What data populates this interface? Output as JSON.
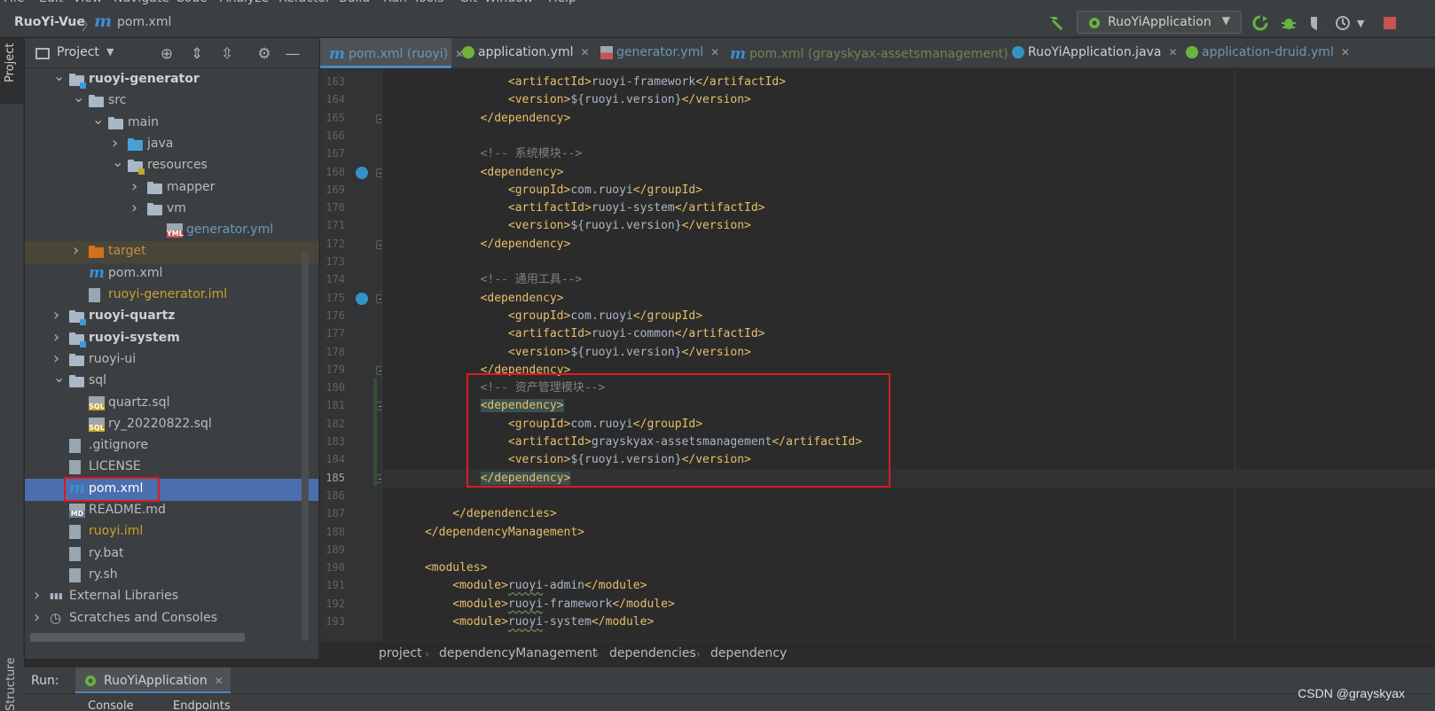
{
  "menu": [
    "File",
    "Edit",
    "View",
    "Navigate",
    "Code",
    "Analyze",
    "Refactor",
    "Build",
    "Run",
    "Tools",
    "Git",
    "Window",
    "Help"
  ],
  "navbar": {
    "project_name": "RuoYi-Vue",
    "file_name": "pom.xml",
    "run_config": "RuoYiApplication"
  },
  "project_panel": {
    "title": "Project"
  },
  "tree": [
    {
      "label": "ruoyi-generator",
      "bold": true
    },
    {
      "label": "src"
    },
    {
      "label": "main"
    },
    {
      "label": "java"
    },
    {
      "label": "resources"
    },
    {
      "label": "mapper"
    },
    {
      "label": "vm"
    },
    {
      "label": "generator.yml"
    },
    {
      "label": "target"
    },
    {
      "label": "pom.xml"
    },
    {
      "label": "ruoyi-generator.iml"
    },
    {
      "label": "ruoyi-quartz",
      "bold": true
    },
    {
      "label": "ruoyi-system",
      "bold": true
    },
    {
      "label": "ruoyi-ui"
    },
    {
      "label": "sql"
    },
    {
      "label": "quartz.sql"
    },
    {
      "label": "ry_20220822.sql"
    },
    {
      "label": ".gitignore"
    },
    {
      "label": "LICENSE"
    },
    {
      "label": "pom.xml",
      "selected": true
    },
    {
      "label": "README.md"
    },
    {
      "label": "ruoyi.iml"
    },
    {
      "label": "ry.bat"
    },
    {
      "label": "ry.sh"
    },
    {
      "label": "External Libraries"
    },
    {
      "label": "Scratches and Consoles"
    }
  ],
  "tabs": [
    {
      "label": "pom.xml (ruoyi)",
      "active": true
    },
    {
      "label": "application.yml"
    },
    {
      "label": "generator.yml"
    },
    {
      "label": "pom.xml (grayskyax-assetsmanagement)"
    },
    {
      "label": "RuoYiApplication.java"
    },
    {
      "label": "application-druid.yml"
    }
  ],
  "code": [
    {
      "n": "163",
      "indent": "            ",
      "parts": [
        [
          "tag",
          "<artifactId>"
        ],
        [
          "txt",
          "ruoyi-framework"
        ],
        [
          "tag",
          "</artifactId>"
        ]
      ]
    },
    {
      "n": "164",
      "indent": "            ",
      "parts": [
        [
          "tag",
          "<version>"
        ],
        [
          "txt",
          "${ruoyi.version}"
        ],
        [
          "tag",
          "</version>"
        ]
      ]
    },
    {
      "n": "165",
      "indent": "        ",
      "parts": [
        [
          "tag",
          "</dependency>"
        ]
      ]
    },
    {
      "n": "166",
      "indent": "",
      "parts": []
    },
    {
      "n": "167",
      "indent": "        ",
      "parts": [
        [
          "comment",
          "<!-- 系统模块-->"
        ]
      ]
    },
    {
      "n": "168",
      "indent": "        ",
      "parts": [
        [
          "tag",
          "<dependency>"
        ]
      ]
    },
    {
      "n": "169",
      "indent": "            ",
      "parts": [
        [
          "tag",
          "<groupId>"
        ],
        [
          "txt",
          "com.ruoyi"
        ],
        [
          "tag",
          "</groupId>"
        ]
      ]
    },
    {
      "n": "170",
      "indent": "            ",
      "parts": [
        [
          "tag",
          "<artifactId>"
        ],
        [
          "txt",
          "ruoyi-system"
        ],
        [
          "tag",
          "</artifactId>"
        ]
      ]
    },
    {
      "n": "171",
      "indent": "            ",
      "parts": [
        [
          "tag",
          "<version>"
        ],
        [
          "txt",
          "${ruoyi.version}"
        ],
        [
          "tag",
          "</version>"
        ]
      ]
    },
    {
      "n": "172",
      "indent": "        ",
      "parts": [
        [
          "tag",
          "</dependency>"
        ]
      ]
    },
    {
      "n": "173",
      "indent": "",
      "parts": []
    },
    {
      "n": "174",
      "indent": "        ",
      "parts": [
        [
          "comment",
          "<!-- 通用工具-->"
        ]
      ]
    },
    {
      "n": "175",
      "indent": "        ",
      "parts": [
        [
          "tag",
          "<dependency>"
        ]
      ]
    },
    {
      "n": "176",
      "indent": "            ",
      "parts": [
        [
          "tag",
          "<groupId>"
        ],
        [
          "txt",
          "com.ruoyi"
        ],
        [
          "tag",
          "</groupId>"
        ]
      ]
    },
    {
      "n": "177",
      "indent": "            ",
      "parts": [
        [
          "tag",
          "<artifactId>"
        ],
        [
          "txt",
          "ruoyi-common"
        ],
        [
          "tag",
          "</artifactId>"
        ]
      ]
    },
    {
      "n": "178",
      "indent": "            ",
      "parts": [
        [
          "tag",
          "<version>"
        ],
        [
          "txt",
          "${ruoyi.version}"
        ],
        [
          "tag",
          "</version>"
        ]
      ]
    },
    {
      "n": "179",
      "indent": "        ",
      "parts": [
        [
          "tag",
          "</dependency>"
        ]
      ]
    },
    {
      "n": "180",
      "indent": "        ",
      "parts": [
        [
          "comment",
          "<!-- 资产管理模块-->"
        ]
      ]
    },
    {
      "n": "181",
      "indent": "        ",
      "parts": [
        [
          "taghl",
          "<dependency>"
        ]
      ]
    },
    {
      "n": "182",
      "indent": "            ",
      "parts": [
        [
          "tag",
          "<groupId>"
        ],
        [
          "txt",
          "com.ruoyi"
        ],
        [
          "tag",
          "</groupId>"
        ]
      ]
    },
    {
      "n": "183",
      "indent": "            ",
      "parts": [
        [
          "tag",
          "<artifactId>"
        ],
        [
          "txt",
          "grayskyax-assetsmanagement"
        ],
        [
          "tag",
          "</artifactId>"
        ]
      ]
    },
    {
      "n": "184",
      "indent": "            ",
      "parts": [
        [
          "tag",
          "<version>"
        ],
        [
          "txt",
          "${ruoyi.version}"
        ],
        [
          "tag",
          "</version>"
        ]
      ]
    },
    {
      "n": "185",
      "indent": "        ",
      "parts": [
        [
          "taghl",
          "</dependency>"
        ]
      ],
      "current": true
    },
    {
      "n": "186",
      "indent": "",
      "parts": []
    },
    {
      "n": "187",
      "indent": "    ",
      "parts": [
        [
          "tag",
          "</dependencies>"
        ]
      ]
    },
    {
      "n": "188",
      "indent": "",
      "parts": [
        [
          "tag",
          "</dependencyManagement>"
        ]
      ]
    },
    {
      "n": "189",
      "indent": "",
      "parts": []
    },
    {
      "n": "190",
      "indent": "",
      "parts": [
        [
          "tag",
          "<modules>"
        ]
      ]
    },
    {
      "n": "191",
      "indent": "    ",
      "parts": [
        [
          "tag",
          "<module>"
        ],
        [
          "sq",
          "ruoyi"
        ],
        [
          "txt",
          "-admin"
        ],
        [
          "tag",
          "</module>"
        ]
      ]
    },
    {
      "n": "192",
      "indent": "    ",
      "parts": [
        [
          "tag",
          "<module>"
        ],
        [
          "sq",
          "ruoyi"
        ],
        [
          "txt",
          "-framework"
        ],
        [
          "tag",
          "</module>"
        ]
      ]
    },
    {
      "n": "193",
      "indent": "    ",
      "parts": [
        [
          "tag",
          "<module>"
        ],
        [
          "sq",
          "ruoyi"
        ],
        [
          "txt",
          "-system"
        ],
        [
          "tag",
          "</module>"
        ]
      ]
    }
  ],
  "breadcrumbs": [
    "project",
    "dependencyManagement",
    "dependencies",
    "dependency"
  ],
  "run_bar": {
    "label": "Run:",
    "tab": "RuoYiApplication"
  },
  "bottom_tabs": [
    "Console",
    "Endpoints"
  ],
  "side_tabs": {
    "left_top": "Project",
    "left_bottom": "Structure"
  },
  "watermark": "CSDN @grayskyax",
  "colors": {
    "accent": "#4a88c7",
    "highlight_box": "#e0191f",
    "xml_tag": "#e8bf6a",
    "comment": "#808080"
  }
}
